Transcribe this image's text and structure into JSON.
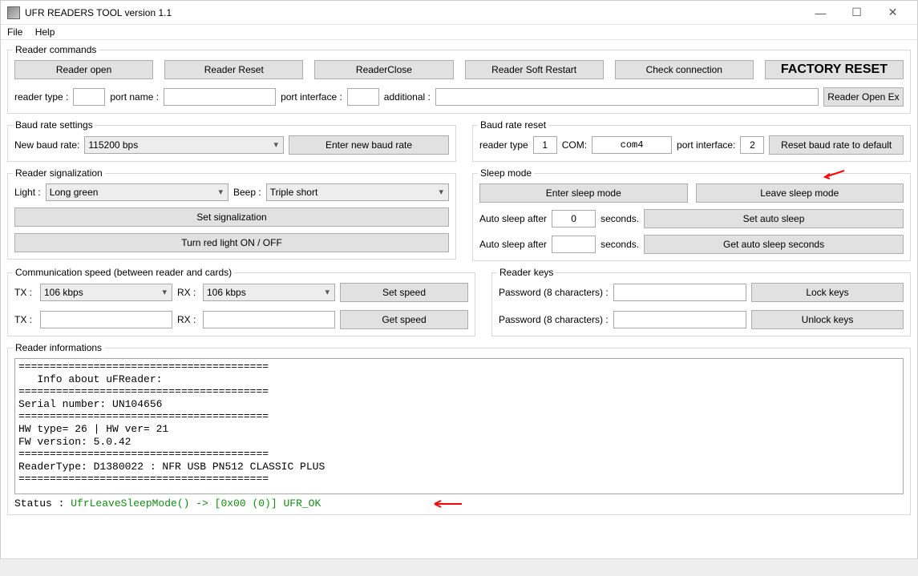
{
  "window": {
    "title": "UFR READERS TOOL version 1.1"
  },
  "menu": {
    "file": "File",
    "help": "Help"
  },
  "reader_commands": {
    "legend": "Reader commands",
    "open": "Reader open",
    "reset": "Reader Reset",
    "close": "ReaderClose",
    "soft_restart": "Reader Soft Restart",
    "check": "Check connection",
    "factory": "FACTORY RESET",
    "reader_type_lbl": "reader type :",
    "port_name_lbl": "port name :",
    "port_iface_lbl": "port interface :",
    "additional_lbl": "additional :",
    "open_ex": "Reader Open Ex"
  },
  "baud_settings": {
    "legend": "Baud rate settings",
    "new_lbl": "New baud rate:",
    "new_val": "115200 bps",
    "enter": "Enter new baud rate"
  },
  "baud_reset": {
    "legend": "Baud rate reset",
    "reader_type_lbl": "reader type",
    "reader_type_val": "1",
    "com_lbl": "COM:",
    "com_val": "com4",
    "port_iface_lbl": "port interface:",
    "port_iface_val": "2",
    "reset_btn": "Reset baud rate to default"
  },
  "signalization": {
    "legend": "Reader signalization",
    "light_lbl": "Light :",
    "light_val": "Long green",
    "beep_lbl": "Beep :",
    "beep_val": "Triple short",
    "set": "Set signalization",
    "red": "Turn red light ON / OFF"
  },
  "sleep": {
    "legend": "Sleep mode",
    "enter": "Enter sleep mode",
    "leave": "Leave sleep mode",
    "auto_after_lbl": "Auto sleep after",
    "auto_after_val": "0",
    "seconds": "seconds.",
    "set_auto": "Set auto sleep",
    "get_auto": "Get auto sleep seconds"
  },
  "comm_speed": {
    "legend": "Communication speed (between reader and cards)",
    "tx_lbl": "TX :",
    "tx_val": "106 kbps",
    "rx_lbl": "RX :",
    "rx_val": "106 kbps",
    "set": "Set speed",
    "get": "Get speed"
  },
  "keys": {
    "legend": "Reader keys",
    "pwd_lbl": "Password (8 characters) :",
    "lock": "Lock keys",
    "unlock": "Unlock keys"
  },
  "infos": {
    "legend": "Reader informations",
    "text": "========================================\n   Info about uFReader:\n========================================\nSerial number: UN104656\n========================================\nHW type= 26 | HW ver= 21\nFW version: 5.0.42\n========================================\nReaderType: D1380022 : NFR USB PN512 CLASSIC PLUS\n========================================",
    "status_lbl": "Status :  ",
    "status_val": "UfrLeaveSleepMode() -> [0x00 (0)] UFR_OK"
  }
}
